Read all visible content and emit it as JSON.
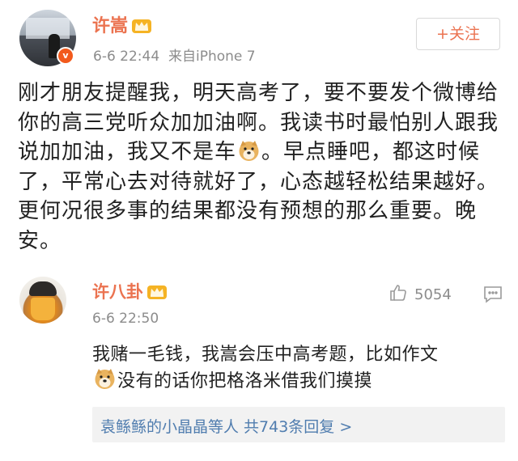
{
  "post": {
    "author": "许嵩",
    "vip_badge": "v",
    "timestamp": "6-6 22:44",
    "source": "来自iPhone 7",
    "follow_label": "+关注",
    "text_parts": [
      "刚才朋友提醒我，明天高考了，要不要发个微博给你的高三党听众加加油啊。我读书时最怕别人跟我说加加油，我又不是车",
      "。早点睡吧，都这时候了，平常心去对待就好了，心态越轻松结果越好。更何况很多事的结果都没有预想的那么重要。晚安。"
    ],
    "emoji_icon": "doge-emoji"
  },
  "reply": {
    "author": "许八卦",
    "timestamp": "6-6 22:50",
    "likes": "5054",
    "text_parts": [
      "我赌一毛钱，我嵩会压中高考题，比如作文",
      "没有的话你把格洛米借我们摸摸"
    ],
    "emoji_icon": "doge-emoji",
    "more_replies": "袁鲧鲧的小晶晶等人 共743条回复 >"
  },
  "colors": {
    "accent": "#eb7350",
    "link": "#507daf",
    "meta": "#8c8c8c"
  }
}
